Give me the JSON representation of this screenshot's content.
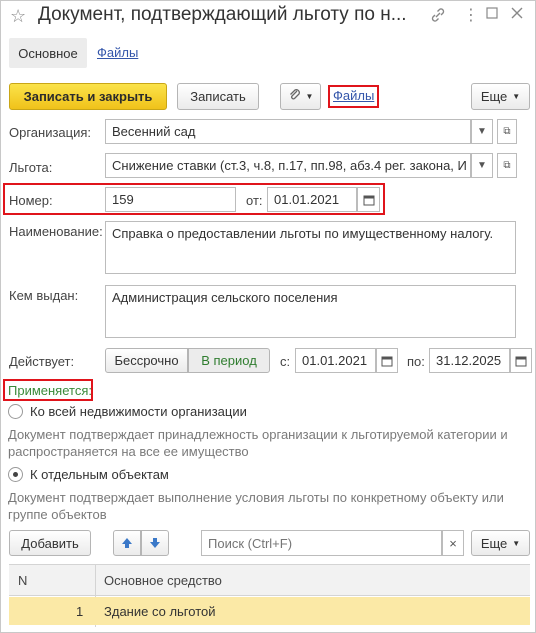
{
  "window": {
    "title": "Документ, подтверждающий льготу по н...",
    "star_icon": "star-icon",
    "link_icon": "link-icon",
    "menu_icon": "kebab-menu-icon",
    "minimize_icon": "minimize-icon",
    "maximize_icon": "maximize-icon",
    "close_icon": "close-icon"
  },
  "tabs": [
    {
      "label": "Основное",
      "active": true
    },
    {
      "label": "Файлы",
      "active": false
    }
  ],
  "toolbar": {
    "save_close_label": "Записать и закрыть",
    "save_label": "Записать",
    "attach_icon": "paperclip-icon",
    "files_link": "Файлы",
    "more_label": "Еще"
  },
  "form": {
    "organization_label": "Организация:",
    "organization_value": "Весенний сад",
    "benefit_label": "Льгота:",
    "benefit_value": "Снижение ставки (ст.3, ч.8, п.17, пп.98, абз.4 рег. закона, И",
    "number_label": "Номер:",
    "number_value": "159",
    "from_label": "от:",
    "from_value": "01.01.2021",
    "name_label": "Наименование:",
    "name_value": "Справка о предоставлении льготы по имущественному налогу.",
    "issued_label": "Кем выдан:",
    "issued_value": "Администрация сельского поселения",
    "valid_label": "Действует:",
    "perpetual_label": "Бессрочно",
    "period_label": "В период",
    "period_from_label": "с:",
    "period_from_value": "01.01.2021",
    "period_to_label": "по:",
    "period_to_value": "31.12.2025"
  },
  "applies": {
    "title": "Применяется:",
    "option1_label": "Ко всей недвижимости организации",
    "option1_desc": "Документ подтверждает принадлежность организации к льготируемой категории и распространяется на все ее имущество",
    "option2_label": "К отдельным объектам",
    "option2_desc": "Документ подтверждает выполнение условия льготы по конкретному объекту или группе объектов",
    "selected": "option2"
  },
  "table_toolbar": {
    "add_label": "Добавить",
    "search_placeholder": "Поиск (Ctrl+F)",
    "more_label": "Еще"
  },
  "table": {
    "columns": [
      "N",
      "Основное средство"
    ],
    "rows": [
      {
        "n": "1",
        "asset": "Здание со льготой"
      }
    ]
  },
  "colors": {
    "accent_yellow": "#f5d130",
    "highlight_red": "#e0141b",
    "selected_row": "#fbe9a6",
    "link_blue": "#3355aa",
    "title_green": "#3a8a3a"
  }
}
